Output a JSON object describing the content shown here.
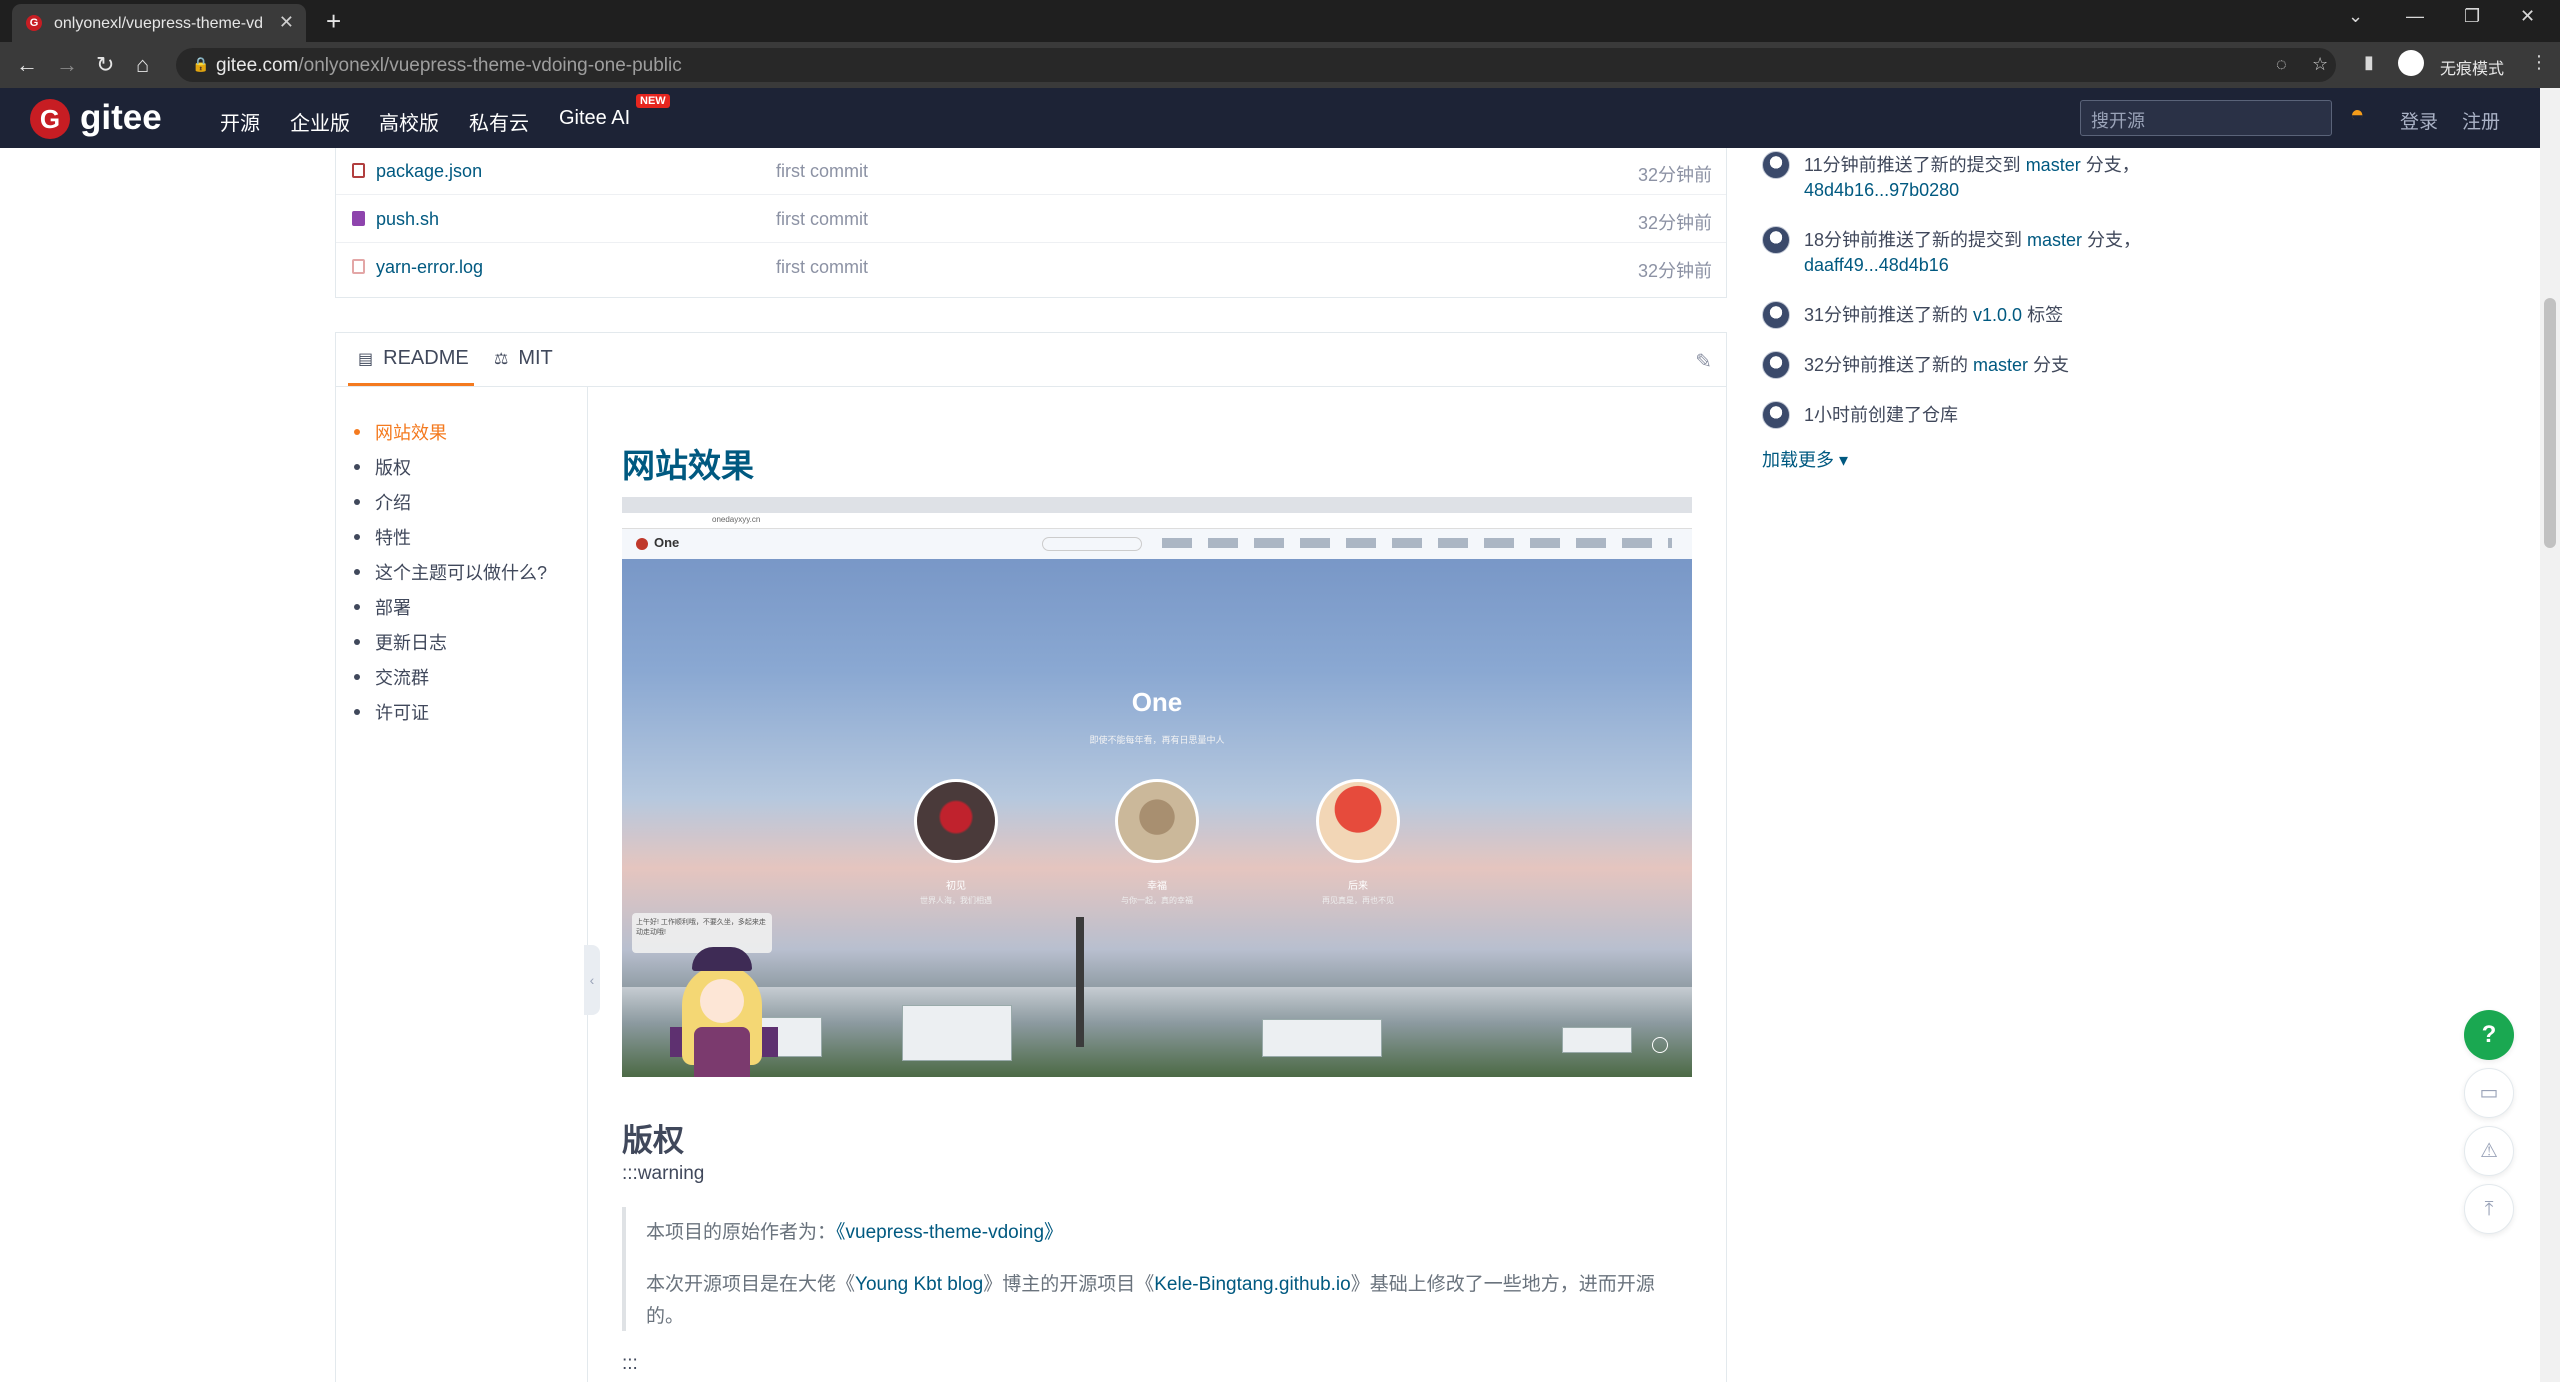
{
  "browser": {
    "tab_title": "onlyonexl/vuepress-theme-vd",
    "tab_close": "✕",
    "new_tab": "+",
    "url_host": "gitee.com",
    "url_path": "/onlyonexl/vuepress-theme-vdoing-one-public",
    "incognito_label": "无痕模式"
  },
  "gitee": {
    "logo_text": "gitee",
    "nav": [
      "开源",
      "企业版",
      "高校版",
      "私有云",
      "Gitee AI"
    ],
    "new_badge": "NEW",
    "search_placeholder": "搜开源",
    "login": "登录",
    "register": "注册"
  },
  "files": [
    {
      "name": "package.json",
      "message": "first commit",
      "time": "32分钟前"
    },
    {
      "name": "push.sh",
      "message": "first commit",
      "time": "32分钟前"
    },
    {
      "name": "yarn-error.log",
      "message": "first commit",
      "time": "32分钟前"
    }
  ],
  "readme": {
    "tabs": [
      "README",
      "MIT"
    ],
    "toc": [
      "网站效果",
      "版权",
      "介绍",
      "特性",
      "这个主题可以做什么?",
      "部署",
      "更新日志",
      "交流群",
      "许可证"
    ],
    "h1": "网站效果",
    "h2": "版权",
    "warning": ":::warning",
    "quote_line1_prefix": "本项目的原始作者为：",
    "quote_line1_link": "《vuepress-theme-vdoing》",
    "quote_line2_prefix": "本次开源项目是在大佬《",
    "quote_line2_link1": "Young Kbt blog",
    "quote_line2_mid": "》博主的开源项目《",
    "quote_line2_link2": "Kele-Bingtang.github.io",
    "quote_line2_suffix": "》基础上修改了一些地方，进而开源的。",
    "closing": ":::",
    "preview": {
      "brand": "One",
      "url": "onedayxyy.cn",
      "title": "One",
      "subtitle": "即使不能每年看，再有日思量中人",
      "bubble": "上午好! 工作顺利哦，不要久坐，多起来走动走动哦!",
      "cards": [
        {
          "label": "初见",
          "desc": "世界人海，我们相遇"
        },
        {
          "label": "幸福",
          "desc": "与你一起，真的幸福"
        },
        {
          "label": "后来",
          "desc": "再见真是，再也不见"
        }
      ]
    }
  },
  "activity": [
    {
      "prefix": "11分钟前推送了新的提交到 ",
      "branch": "master",
      "mid": " 分支，",
      "ref": "48d4b16...97b0280"
    },
    {
      "prefix": "18分钟前推送了新的提交到 ",
      "branch": "master",
      "mid": " 分支，",
      "ref": "daaff49...48d4b16"
    },
    {
      "prefix": "31分钟前推送了新的 ",
      "branch": "v1.0.0",
      "mid": " 标签",
      "ref": ""
    },
    {
      "prefix": "32分钟前推送了新的 ",
      "branch": "master",
      "mid": " 分支",
      "ref": ""
    },
    {
      "prefix": "1小时前创建了仓库",
      "branch": "",
      "mid": "",
      "ref": ""
    }
  ],
  "load_more": "加载更多 ▾",
  "fab": {
    "help": "?"
  },
  "colors": {
    "brand": "#c71d23",
    "link": "#005980",
    "accent": "#f47a1f",
    "header": "#1d2336",
    "help": "#1aa851"
  }
}
